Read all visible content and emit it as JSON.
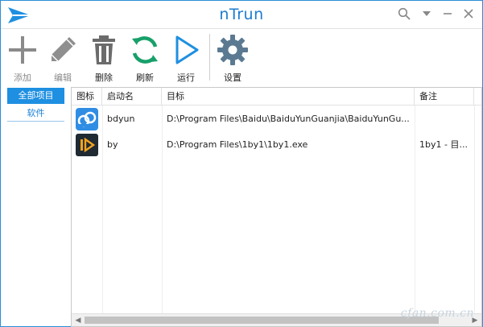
{
  "app": {
    "title": "nTrun"
  },
  "toolbar": {
    "add_label": "添加",
    "edit_label": "编辑",
    "delete_label": "删除",
    "refresh_label": "刷新",
    "run_label": "运行",
    "settings_label": "设置"
  },
  "sidebar": {
    "items": [
      {
        "label": "全部项目"
      },
      {
        "label": "软件"
      }
    ]
  },
  "list": {
    "columns": [
      "图标",
      "启动名",
      "目标",
      "备注"
    ],
    "rows": [
      {
        "name": "bdyun",
        "target": "D:\\Program Files\\Baidu\\BaiduYunGuanjia\\BaiduYunGu...",
        "note": ""
      },
      {
        "name": "by",
        "target": "D:\\Program Files\\1by1\\1by1.exe",
        "note": "1by1 - 目..."
      }
    ]
  },
  "watermark": "cfan.com.cn",
  "colors": {
    "accent": "#1e8fe1",
    "title": "#1d7bd0",
    "refresh_green": "#18a06a",
    "disabled_gray": "#8a8a8a"
  }
}
